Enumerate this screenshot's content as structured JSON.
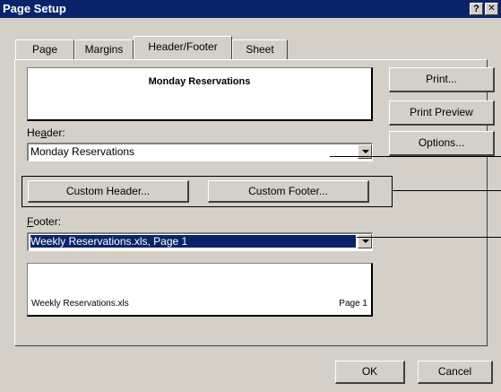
{
  "window": {
    "title": "Page Setup",
    "help_glyph": "?",
    "close_glyph": "✕"
  },
  "tabs": [
    {
      "label": "Page"
    },
    {
      "label": "Margins"
    },
    {
      "label": "Header/Footer",
      "active": true
    },
    {
      "label": "Sheet"
    }
  ],
  "header_preview": {
    "text": "Monday Reservations"
  },
  "header": {
    "label": "Header:",
    "value": "Monday Reservations"
  },
  "custom_buttons": {
    "custom_header": "Custom Header...",
    "custom_footer": "Custom Footer..."
  },
  "footer": {
    "label": "Footer:",
    "value": "Weekly Reservations.xls, Page 1"
  },
  "footer_preview": {
    "left_text": "Weekly Reservations.xls",
    "right_text": "Page 1"
  },
  "side_buttons": {
    "print": "Print...",
    "print_preview": "Print Preview",
    "options": "Options..."
  },
  "bottom_buttons": {
    "ok": "OK",
    "cancel": "Cancel"
  },
  "colors": {
    "title_bar": "#0a246a",
    "face": "#d4d0c8",
    "selection": "#0a246a"
  }
}
